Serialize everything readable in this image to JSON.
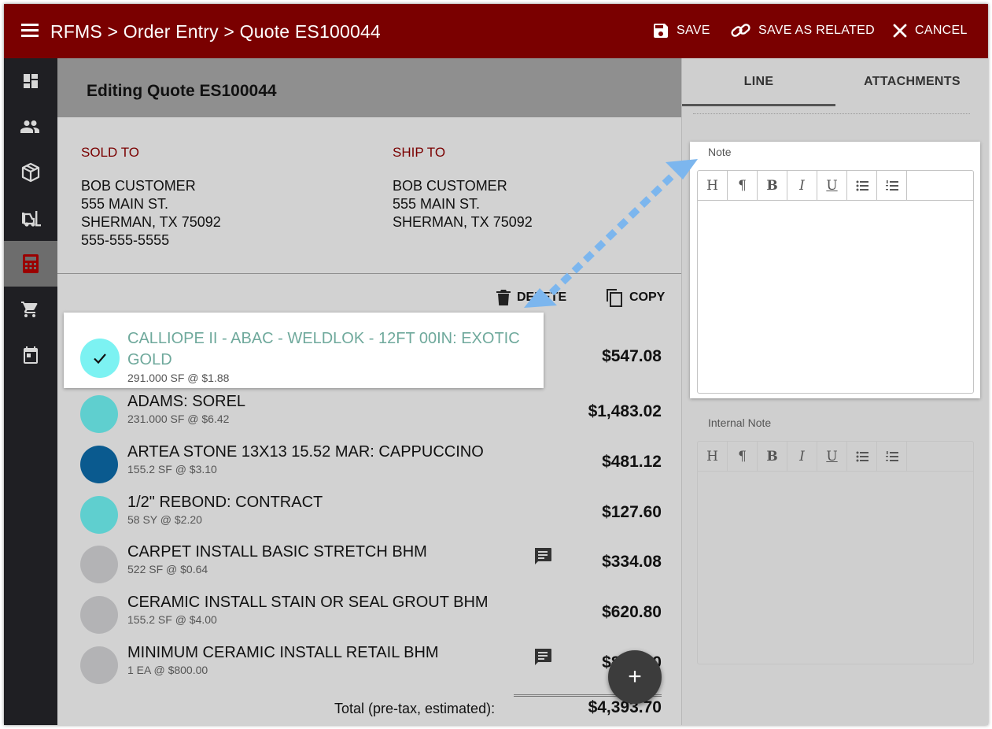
{
  "header": {
    "breadcrumb": "RFMS > Order Entry > Quote ES100044",
    "save_label": "SAVE",
    "save_related_label": "SAVE AS RELATED",
    "cancel_label": "CANCEL"
  },
  "nav": {
    "items": [
      {
        "icon": "dashboard-icon"
      },
      {
        "icon": "people-icon"
      },
      {
        "icon": "package-icon"
      },
      {
        "icon": "forklift-icon"
      },
      {
        "icon": "calculator-icon",
        "active": true
      },
      {
        "icon": "cart-icon"
      },
      {
        "icon": "calendar-icon"
      }
    ]
  },
  "quote": {
    "title": "Editing Quote ES100044",
    "sold_to": {
      "label": "SOLD TO",
      "name": "BOB CUSTOMER",
      "street": "555 MAIN ST.",
      "city": "SHERMAN, TX 75092",
      "phone": "555-555-5555"
    },
    "ship_to": {
      "label": "SHIP TO",
      "name": "BOB CUSTOMER",
      "street": "555 MAIN ST.",
      "city": "SHERMAN, TX 75092"
    },
    "delete_label": "DELETE",
    "copy_label": "COPY",
    "lines": [
      {
        "name": "CALLIOPE II - ABAC - WELDLOK - 12FT 00IN: EXOTIC GOLD",
        "detail": "291.000 SF @ $1.88",
        "amount": "$547.08",
        "color": "#7cf2f2",
        "selected": true
      },
      {
        "name": "ADAMS: SOREL",
        "detail": "231.000 SF @ $6.42",
        "amount": "$1,483.02",
        "color": "#5fcfcf"
      },
      {
        "name": "ARTEA STONE 13X13 15.52 MAR: CAPPUCCINO",
        "detail": "155.2 SF @ $3.10",
        "amount": "$481.12",
        "color": "#0a5a8f"
      },
      {
        "name": "1/2\" REBOND: CONTRACT",
        "detail": "58 SY @ $2.20",
        "amount": "$127.60",
        "color": "#5fcfcf"
      },
      {
        "name": "CARPET INSTALL BASIC STRETCH BHM",
        "detail": "522 SF @ $0.64",
        "amount": "$334.08",
        "color": "#b3b3b5",
        "has_note": true
      },
      {
        "name": "CERAMIC INSTALL STAIN OR SEAL GROUT BHM",
        "detail": "155.2 SF @ $4.00",
        "amount": "$620.80",
        "color": "#b3b3b5"
      },
      {
        "name": "MINIMUM CERAMIC INSTALL RETAIL BHM",
        "detail": "1 EA @ $800.00",
        "amount": "$800.00",
        "color": "#b3b3b5",
        "has_note": true
      }
    ],
    "total_label": "Total (pre-tax, estimated):",
    "total_amount": "$4,393.70",
    "fab_label": "+"
  },
  "sidepanel": {
    "tabs": [
      {
        "label": "LINE",
        "active": true
      },
      {
        "label": "ATTACHMENTS"
      }
    ],
    "note_label": "Note",
    "internal_note_label": "Internal Note",
    "toolbar": [
      "H",
      "¶",
      "B",
      "I",
      "U",
      "bulleted-list-icon",
      "numbered-list-icon"
    ]
  },
  "colors": {
    "header_bg": "#7a0000",
    "accent_red": "#7a0000",
    "selected_text": "#6fa99c",
    "arrow": "#7cb6ee"
  }
}
